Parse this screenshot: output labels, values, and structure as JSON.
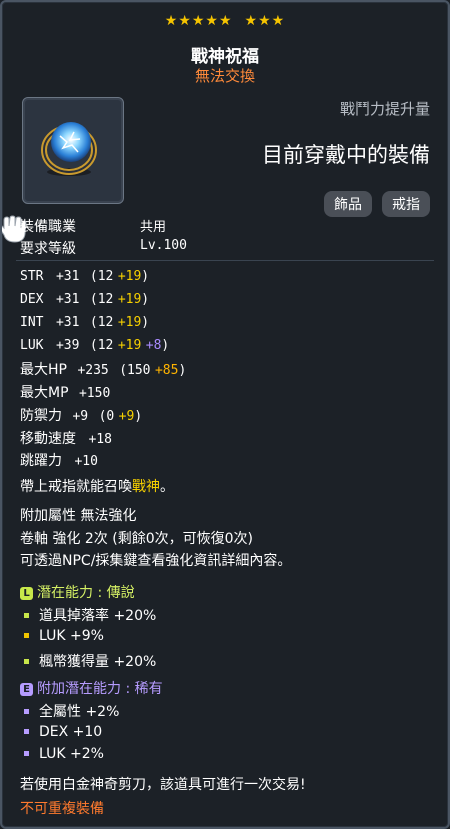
{
  "header": {
    "stars_left": "★★★★★",
    "stars_right": "★★★",
    "title": "戰神祝福",
    "subtitle": "無法交換"
  },
  "power_label": "戰鬥力提升量",
  "equipped_label": "目前穿戴中的裝備",
  "tags": [
    "飾品",
    "戒指"
  ],
  "requirements": [
    {
      "label": "裝備職業",
      "value": "共用"
    },
    {
      "label": "要求等級",
      "value": "Lv.100"
    }
  ],
  "stats": {
    "str": {
      "name": "STR",
      "total": "+31",
      "open": "(12",
      "bonus": "+19",
      "close": ")"
    },
    "dex": {
      "name": "DEX",
      "total": "+31",
      "open": "(12",
      "bonus": "+19",
      "close": ")"
    },
    "int": {
      "name": "INT",
      "total": "+31",
      "open": "(12",
      "bonus": "+19",
      "close": ")"
    },
    "luk": {
      "name": "LUK",
      "total": "+39",
      "open": "(12",
      "bonus": "+19",
      "bonus2": "+8",
      "close": ")"
    },
    "hp": {
      "name": "最大HP",
      "total": "+235",
      "open": "(150",
      "bonus": "+85",
      "close": ")"
    },
    "mp": {
      "name": "最大MP",
      "total": "+150"
    },
    "def": {
      "name": "防禦力",
      "total": "+9",
      "open": "(0",
      "bonus": "+9",
      "close": ")"
    },
    "speed": {
      "name": "移動速度",
      "total": "+18"
    },
    "jump": {
      "name": "跳躍力",
      "total": "+10"
    }
  },
  "summon_text": {
    "prefix": "帶上戒指就能召喚",
    "highlight": "戰神",
    "suffix": "。"
  },
  "extra": {
    "attr": "附加屬性 無法強化",
    "scroll": "卷軸 強化 2次 (剩餘0次，可恢復0次)",
    "hint": "可透過NPC/採集鍵查看強化資訊詳細內容。"
  },
  "potential": {
    "badge": "L",
    "label": "潛在能力 : 傳說",
    "lines": [
      "道具掉落率 +20%",
      "LUK +9%",
      "楓幣獲得量 +20%"
    ]
  },
  "additional_potential": {
    "badge": "E",
    "label": "附加潛在能力 : 稀有",
    "lines": [
      "全屬性 +2%",
      "DEX +10",
      "LUK +2%"
    ]
  },
  "footer": {
    "trade_note": "若使用白金神奇剪刀，該道具可進行一次交易!",
    "no_duplicate": "不可重複裝備"
  },
  "colors": {
    "bonus": "#f6d000",
    "bonus2": "#a98cff",
    "hp_bonus": "#ffb400",
    "no_duplicate": "#ff7a2e",
    "potential_label": "#d4ef64",
    "additional_label": "#b69cff"
  }
}
